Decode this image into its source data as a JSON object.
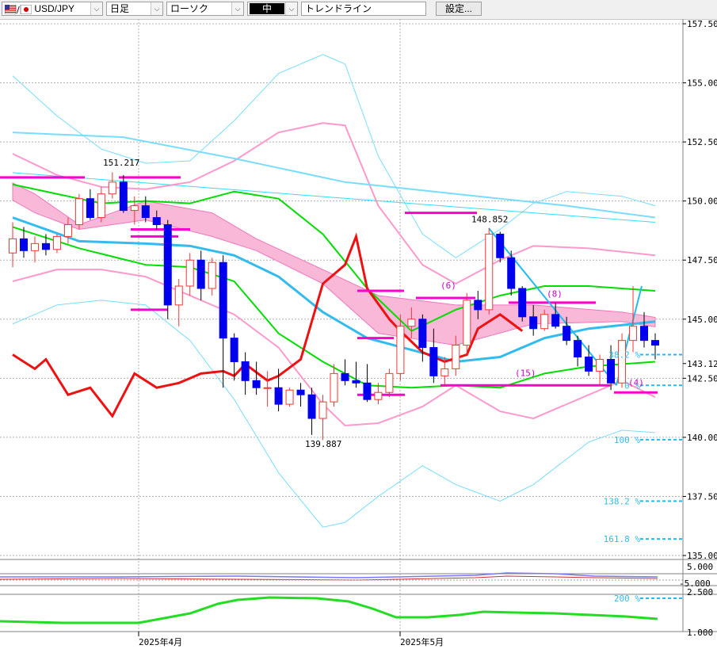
{
  "toolbar": {
    "symbol": "USD/JPY",
    "timeframe": "日足",
    "chart_type": "ローソク",
    "line_width": "中",
    "tool": "トレンドライン",
    "settings_label": "設定..."
  },
  "axis": {
    "price_ticks": [
      "157.50",
      "155.00",
      "152.50",
      "150.00",
      "147.50",
      "145.00",
      "143.122",
      "142.50",
      "140.00",
      "137.50",
      "135.00"
    ],
    "osc1_ticks": [
      "5.000",
      "-5.000"
    ],
    "osc2_ticks": [
      "2.500",
      "1.000"
    ],
    "x_labels": [
      "2025年4月",
      "2025年5月"
    ]
  },
  "annotations": {
    "high_1": "151.217",
    "high_2": "148.852",
    "low_1": "139.887",
    "count_6": "(6)",
    "count_8": "(8)",
    "count_15": "(15)",
    "count_4": "(4)"
  },
  "fib_labels": [
    "38.2 %",
    "0 %",
    "100 %",
    "138.2 %",
    "161.8 %",
    "200 %"
  ],
  "colors": {
    "bull": "#ff3333",
    "bear": "#0000ee",
    "cloud": "#f9b8d8",
    "kijun": "#33bbee",
    "lagging": "#ee1111",
    "bands_mid": "#00dd00",
    "bands_outer": "#ff99cc",
    "bands_3sigma": "#77ddff",
    "magenta_levels": "#ff00cc",
    "fib": "#22bbee"
  },
  "chart_data": {
    "type": "candlestick",
    "symbol": "USD/JPY",
    "timeframe": "日足",
    "ylim": [
      135.0,
      157.5
    ],
    "candles_ohlc": [
      [
        147.8,
        149.1,
        147.2,
        148.4
      ],
      [
        148.4,
        148.9,
        147.6,
        147.9
      ],
      [
        147.9,
        148.5,
        147.4,
        148.2
      ],
      [
        148.2,
        148.6,
        147.7,
        147.95
      ],
      [
        147.95,
        148.6,
        147.8,
        148.5
      ],
      [
        148.5,
        149.3,
        148.2,
        149.0
      ],
      [
        149.0,
        150.3,
        148.8,
        150.1
      ],
      [
        150.1,
        150.5,
        149.2,
        149.3
      ],
      [
        149.3,
        150.6,
        149.1,
        150.3
      ],
      [
        150.3,
        151.217,
        150.1,
        150.8
      ],
      [
        150.8,
        151.1,
        149.5,
        149.6
      ],
      [
        149.6,
        150.2,
        149.0,
        149.8
      ],
      [
        149.8,
        150.2,
        149.1,
        149.3
      ],
      [
        149.3,
        149.6,
        148.8,
        149.0
      ],
      [
        149.0,
        149.2,
        145.0,
        145.6
      ],
      [
        145.6,
        146.7,
        144.7,
        146.4
      ],
      [
        146.4,
        147.8,
        146.0,
        147.5
      ],
      [
        147.5,
        147.9,
        145.8,
        146.3
      ],
      [
        146.3,
        147.6,
        146.0,
        147.4
      ],
      [
        147.4,
        147.7,
        142.1,
        144.2
      ],
      [
        144.2,
        144.4,
        142.4,
        143.2
      ],
      [
        143.2,
        143.6,
        141.8,
        142.4
      ],
      [
        142.4,
        143.2,
        141.8,
        142.1
      ],
      [
        142.1,
        142.8,
        141.3,
        142.1
      ],
      [
        142.1,
        142.9,
        141.1,
        141.4
      ],
      [
        141.4,
        142.1,
        141.3,
        142.0
      ],
      [
        142.0,
        142.3,
        141.3,
        141.8
      ],
      [
        141.8,
        142.1,
        140.1,
        140.8
      ],
      [
        140.8,
        141.8,
        139.887,
        141.5
      ],
      [
        141.5,
        143.1,
        141.3,
        142.7
      ],
      [
        142.7,
        143.3,
        142.2,
        142.4
      ],
      [
        142.4,
        143.2,
        142.1,
        142.3
      ],
      [
        142.3,
        143.1,
        141.5,
        141.6
      ],
      [
        141.6,
        142.3,
        141.4,
        141.9
      ],
      [
        141.9,
        142.9,
        141.7,
        142.7
      ],
      [
        142.7,
        145.2,
        142.4,
        144.7
      ],
      [
        144.7,
        145.5,
        144.2,
        145.0
      ],
      [
        145.0,
        145.2,
        143.2,
        143.8
      ],
      [
        143.8,
        144.6,
        142.3,
        142.6
      ],
      [
        142.6,
        143.4,
        142.2,
        142.9
      ],
      [
        142.9,
        144.3,
        142.6,
        143.9
      ],
      [
        143.9,
        146.1,
        143.5,
        145.8
      ],
      [
        145.8,
        146.2,
        145.0,
        145.4
      ],
      [
        145.4,
        148.852,
        145.2,
        148.6
      ],
      [
        148.6,
        148.7,
        147.4,
        147.6
      ],
      [
        147.6,
        147.9,
        146.0,
        146.3
      ],
      [
        146.3,
        146.4,
        144.9,
        145.1
      ],
      [
        145.1,
        145.6,
        144.3,
        144.6
      ],
      [
        144.6,
        145.4,
        144.5,
        145.2
      ],
      [
        145.2,
        145.7,
        144.6,
        144.7
      ],
      [
        144.7,
        145.1,
        143.9,
        144.1
      ],
      [
        144.1,
        144.3,
        143.0,
        143.4
      ],
      [
        143.4,
        143.9,
        142.6,
        142.8
      ],
      [
        142.8,
        143.5,
        142.2,
        143.3
      ],
      [
        143.3,
        143.9,
        142.0,
        142.3
      ],
      [
        142.3,
        144.4,
        142.1,
        144.1
      ],
      [
        144.1,
        146.4,
        143.6,
        144.7
      ],
      [
        144.7,
        145.3,
        143.8,
        144.1
      ],
      [
        144.1,
        144.4,
        143.3,
        143.9
      ]
    ]
  }
}
